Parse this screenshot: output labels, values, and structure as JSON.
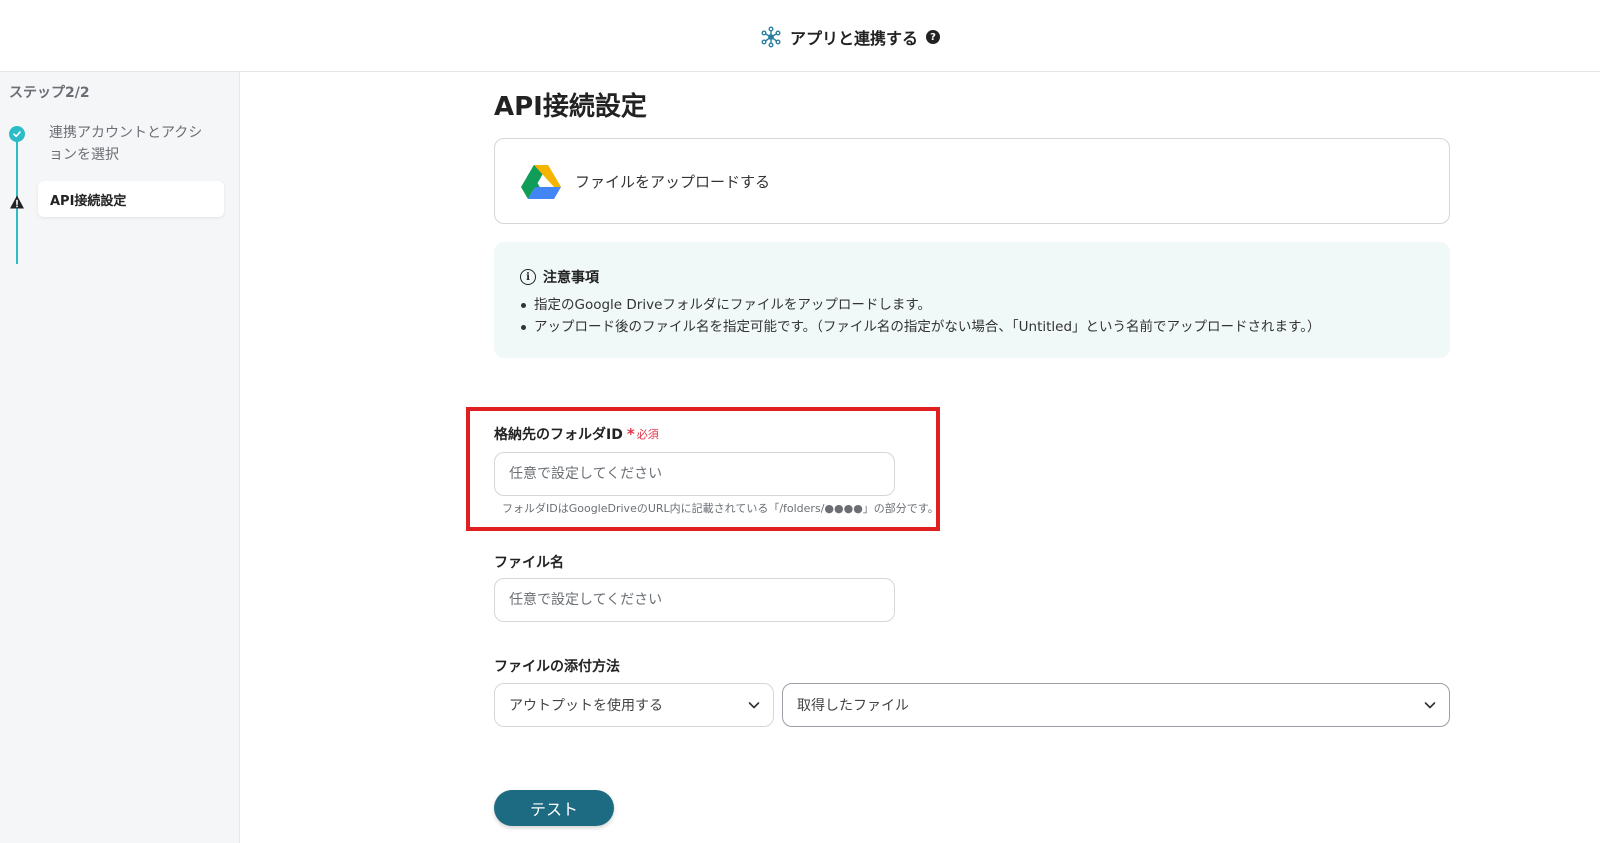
{
  "header": {
    "title": "アプリと連携する",
    "help": "?"
  },
  "sidebar": {
    "step_count": "ステップ2/2",
    "steps": [
      {
        "label": "連携アカウントとアクションを選択",
        "status": "complete"
      },
      {
        "label": "API接続設定",
        "status": "current"
      }
    ]
  },
  "main": {
    "title": "API接続設定",
    "app_card": {
      "icon": "google-drive-icon",
      "action_label": "ファイルをアップロードする"
    },
    "notice": {
      "icon": "info-icon",
      "title": "注意事項",
      "items": [
        "指定のGoogle Driveフォルダにファイルをアップロードします。",
        "アップロード後のファイル名を指定可能です。（ファイル名の指定がない場合、「Untitled」という名前でアップロードされます。）"
      ]
    },
    "folder_field": {
      "label": "格納先のフォルダID",
      "required_mark": "*",
      "required_text": "必須",
      "placeholder": "任意で設定してください",
      "value": "",
      "hint": "フォルダIDはGoogleDriveのURL内に記載されている「/folders/●●●●」の部分です。"
    },
    "filename_field": {
      "label": "ファイル名",
      "placeholder": "任意で設定してください",
      "value": ""
    },
    "attach_field": {
      "label": "ファイルの添付方法",
      "method_selected": "アウトプットを使用する",
      "source_selected": "取得したファイル"
    },
    "test_button": "テスト"
  },
  "colors": {
    "accent": "#2bbcc8",
    "primary_button": "#1d6b82",
    "highlight": "#e02020",
    "required": "#e0364a",
    "notice_bg": "#f1f8f8"
  }
}
